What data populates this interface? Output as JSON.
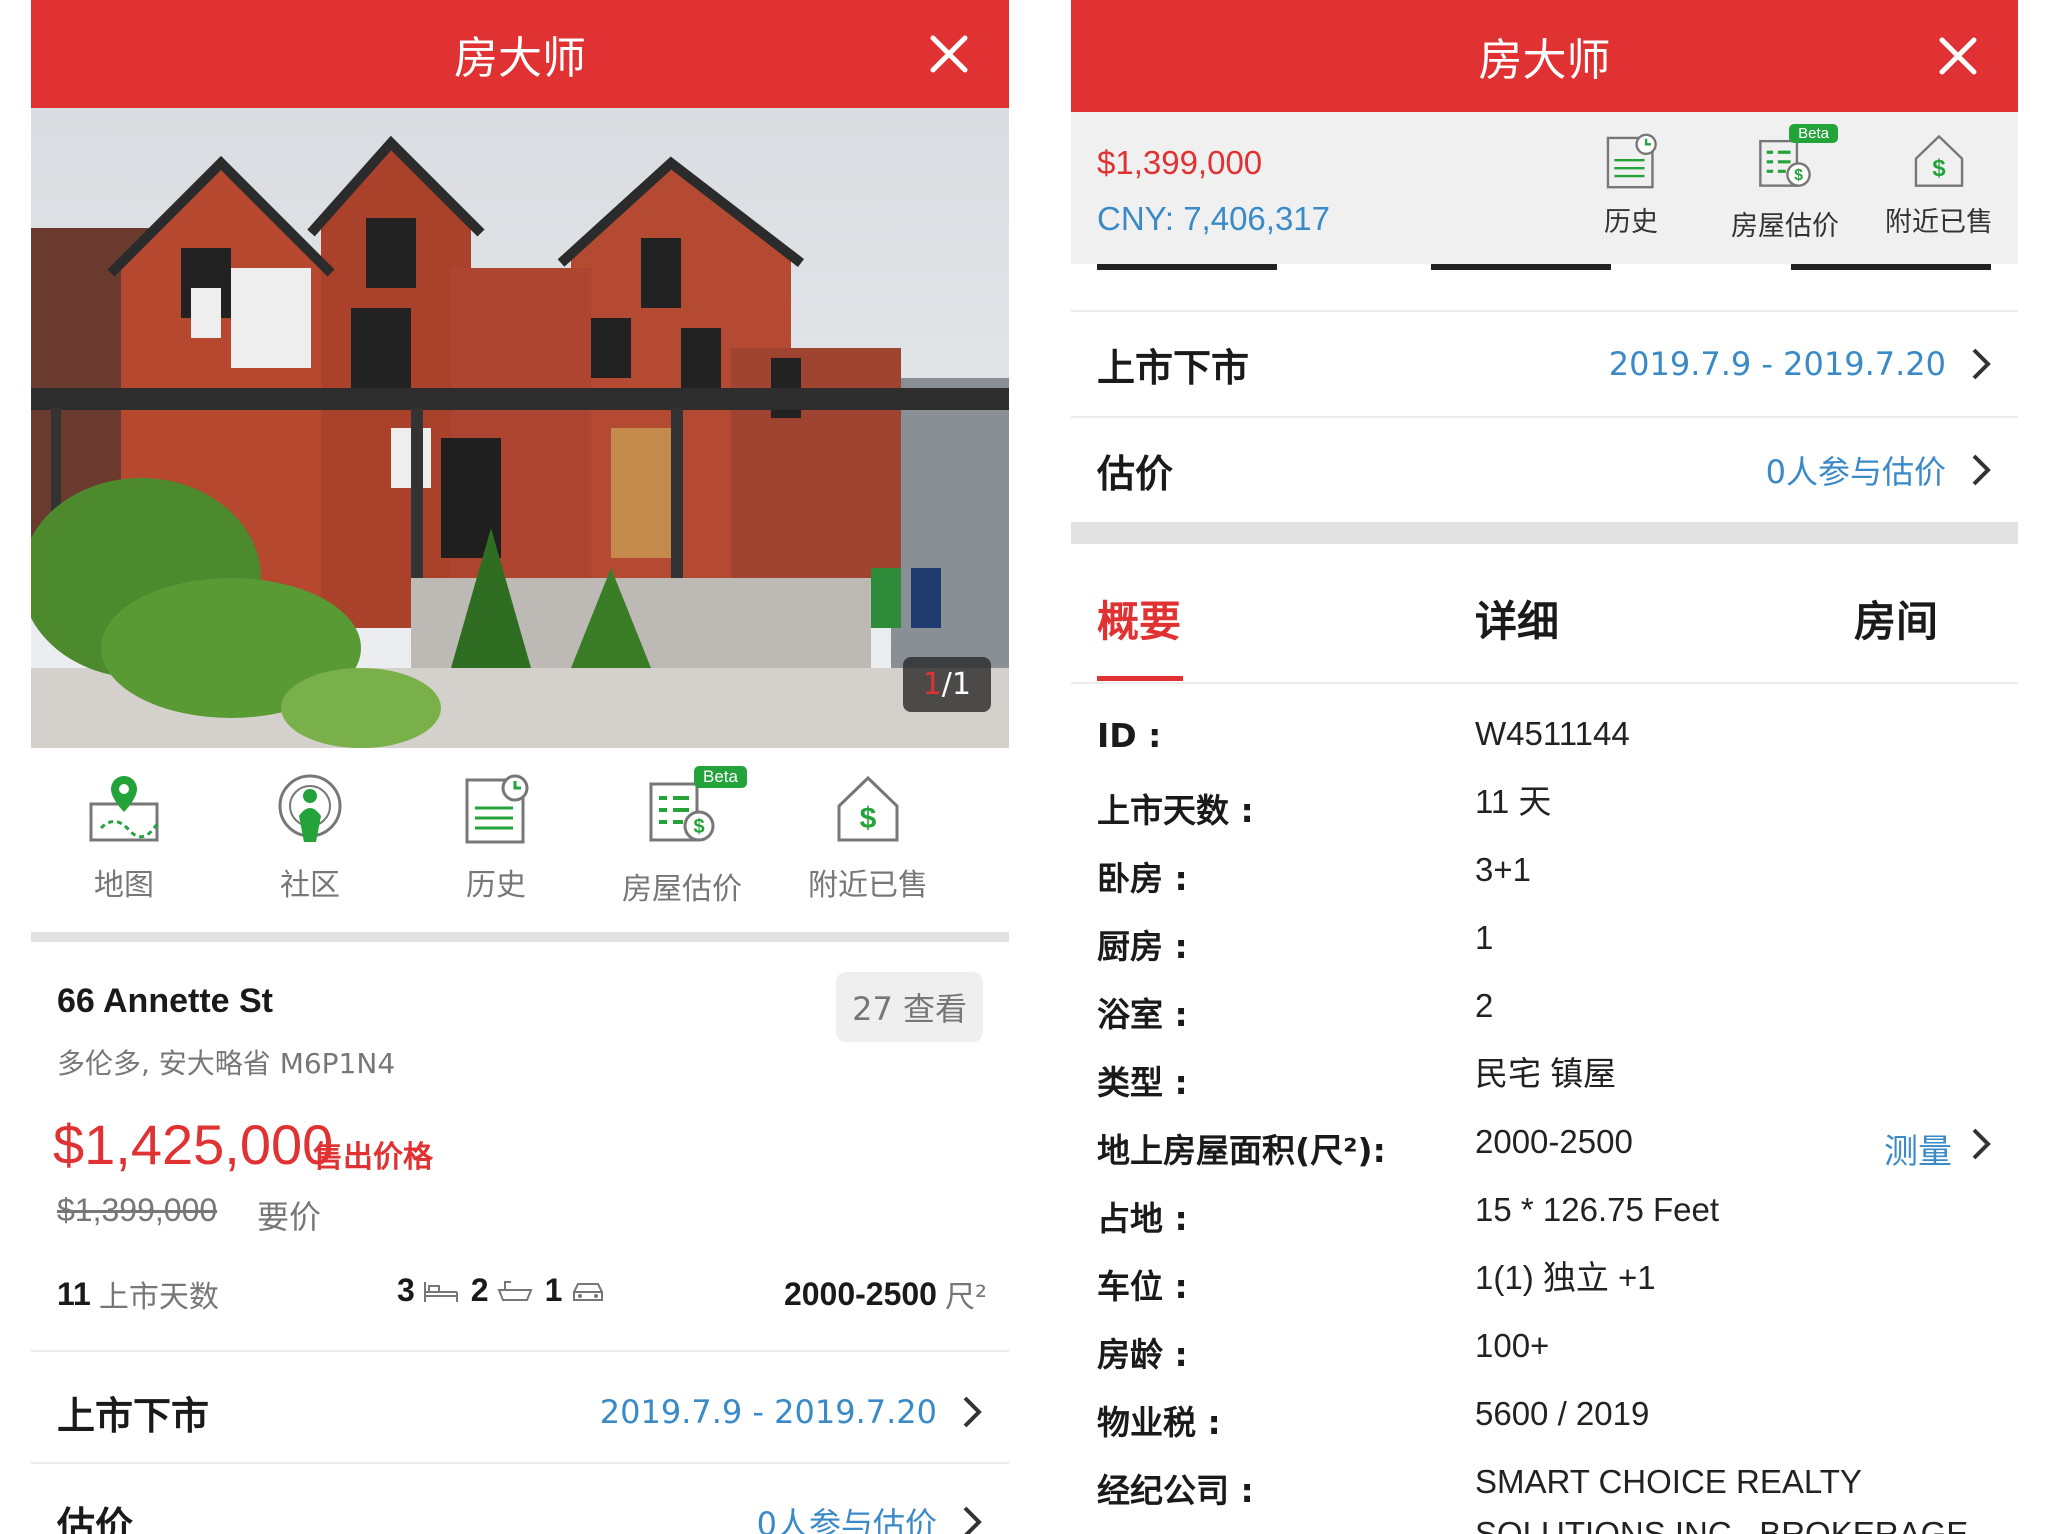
{
  "app_title": "房大师",
  "left": {
    "photo_counter": {
      "current": "1",
      "separator": "/1"
    },
    "icons": [
      {
        "label": "地图",
        "icon": "map-pin-icon"
      },
      {
        "label": "社区",
        "icon": "community-icon"
      },
      {
        "label": "历史",
        "icon": "history-icon"
      },
      {
        "label": "房屋估价",
        "icon": "valuation-icon",
        "badge": "Beta"
      },
      {
        "label": "附近已售",
        "icon": "nearby-sold-icon"
      }
    ],
    "address": "66 Annette St",
    "sub_address": "多伦多, 安大略省 M6P1N4",
    "views": "27 查看",
    "sold_price": "$1,425,000",
    "sold_label": "售出价格",
    "ask_price": "$1,399,000",
    "ask_label": "要价",
    "stats": {
      "days_num": "11",
      "days_label": "上市天数",
      "beds": "3",
      "baths": "2",
      "parking": "1",
      "area": "2000-2500",
      "area_unit": "尺²"
    },
    "rows": [
      {
        "label": "上市下市",
        "value": "2019.7.9 - 2019.7.20"
      },
      {
        "label": "估价",
        "value": "0人参与估价"
      }
    ]
  },
  "right": {
    "price_usd": "$1,399,000",
    "price_cny": "CNY: 7,406,317",
    "icons": [
      {
        "label": "历史",
        "icon": "history-icon"
      },
      {
        "label": "房屋估价",
        "icon": "valuation-icon",
        "badge": "Beta"
      },
      {
        "label": "附近已售",
        "icon": "nearby-sold-icon"
      }
    ],
    "rows": [
      {
        "label": "上市下市",
        "value": "2019.7.9 - 2019.7.20"
      },
      {
        "label": "估价",
        "value": "0人参与估价"
      }
    ],
    "tabs": [
      "概要",
      "详细",
      "房间"
    ],
    "details": [
      {
        "key": "ID :",
        "value": "W4511144"
      },
      {
        "key": "上市天数 :",
        "value": "11 天"
      },
      {
        "key": "卧房 :",
        "value": "3+1"
      },
      {
        "key": "厨房 :",
        "value": "1"
      },
      {
        "key": "浴室 :",
        "value": "2"
      },
      {
        "key": "类型 :",
        "value": "民宅 镇屋"
      },
      {
        "key": "地上房屋面积(尺²):",
        "value": "2000-2500",
        "action": "测量"
      },
      {
        "key": "占地 :",
        "value": "15 * 126.75 Feet"
      },
      {
        "key": "车位 :",
        "value": "1(1) 独立 +1"
      },
      {
        "key": "房龄 :",
        "value": "100+"
      },
      {
        "key": "物业税 :",
        "value": "5600 / 2019"
      },
      {
        "key": "经纪公司 :",
        "value": "SMART CHOICE REALTY SOLUTIONS INC., BROKERAGE"
      }
    ]
  },
  "colors": {
    "brand_red": "#e03232",
    "link_blue": "#3a8ac8",
    "icon_green": "#25a33b"
  }
}
